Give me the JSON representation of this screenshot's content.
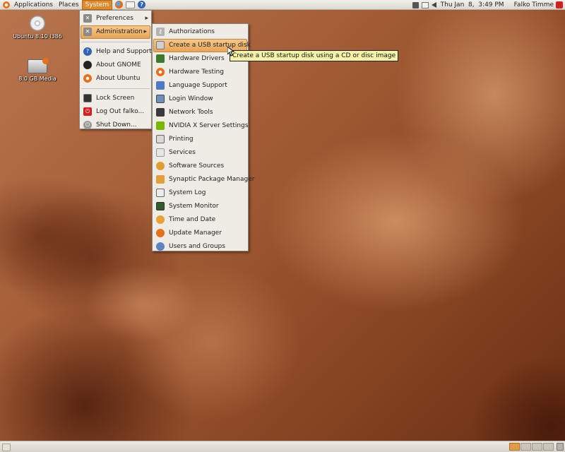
{
  "top_panel": {
    "menus": {
      "applications": "Applications",
      "places": "Places",
      "system": "System"
    },
    "clock": "Thu Jan  8,  3:49 PM",
    "user": "Falko Timme"
  },
  "desktop": {
    "icons": [
      {
        "label": "Ubuntu 8.10 i386"
      },
      {
        "label": "8.0 GB Media"
      }
    ]
  },
  "system_menu": {
    "items": [
      {
        "label": "Preferences"
      },
      {
        "label": "Administration"
      },
      {
        "label": "Help and Support"
      },
      {
        "label": "About GNOME"
      },
      {
        "label": "About Ubuntu"
      },
      {
        "label": "Lock Screen"
      },
      {
        "label": "Log Out falko..."
      },
      {
        "label": "Shut Down..."
      }
    ]
  },
  "admin_menu": {
    "items": [
      {
        "label": "Authorizations"
      },
      {
        "label": "Create a USB startup disk"
      },
      {
        "label": "Hardware Drivers"
      },
      {
        "label": "Hardware Testing"
      },
      {
        "label": "Language Support"
      },
      {
        "label": "Login Window"
      },
      {
        "label": "Network Tools"
      },
      {
        "label": "NVIDIA X Server Settings"
      },
      {
        "label": "Printing"
      },
      {
        "label": "Services"
      },
      {
        "label": "Software Sources"
      },
      {
        "label": "Synaptic Package Manager"
      },
      {
        "label": "System Log"
      },
      {
        "label": "System Monitor"
      },
      {
        "label": "Time and Date"
      },
      {
        "label": "Update Manager"
      },
      {
        "label": "Users and Groups"
      }
    ]
  },
  "tooltip": "Create a USB startup disk using a CD or disc image",
  "colors": {
    "accent": "#e08a2d",
    "highlight": "#e8a456",
    "menu_bg": "#efebe5"
  }
}
